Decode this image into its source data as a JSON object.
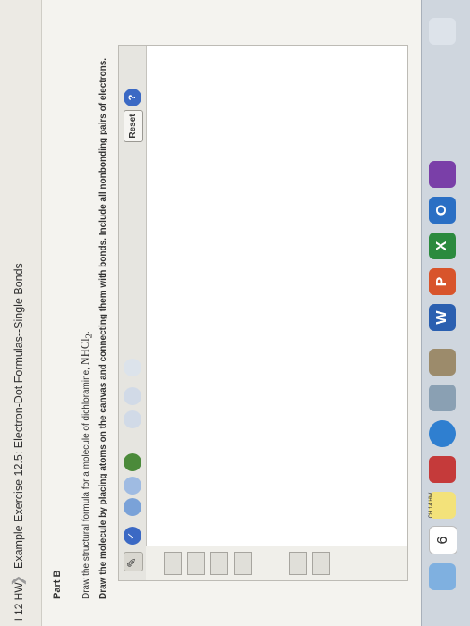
{
  "breadcrumb": {
    "first": "l 12 HW",
    "second": "Example Exercise 12.5: Electron-Dot Formulas--Single Bonds"
  },
  "part": {
    "title": "Part B"
  },
  "instructions": {
    "line1_prefix": "Draw the structural formula for a molecule of dichloramine,",
    "formula": "NHCl",
    "formula_sub": "2",
    "line1_suffix": ".",
    "line2": "Draw the molecule by placing atoms on the canvas and connecting them with bonds. Include all nonbonding pairs of electrons."
  },
  "toolbar": {
    "reset_label": "Reset",
    "help_label": "?"
  },
  "dock": {
    "calendar_day": "6",
    "sticky_label": "CH 14 HW",
    "apps": [
      "finder-icon",
      "calendar-icon",
      "notes-icon",
      "photos-icon",
      "itunes-icon",
      "mail-icon",
      "skype-icon",
      "word-icon",
      "powerpoint-icon",
      "excel-icon",
      "outlook-icon",
      "onenote-icon",
      "trash-icon"
    ]
  },
  "colors": {
    "accent": "#3b69c4",
    "background": "#f4f3ef"
  }
}
